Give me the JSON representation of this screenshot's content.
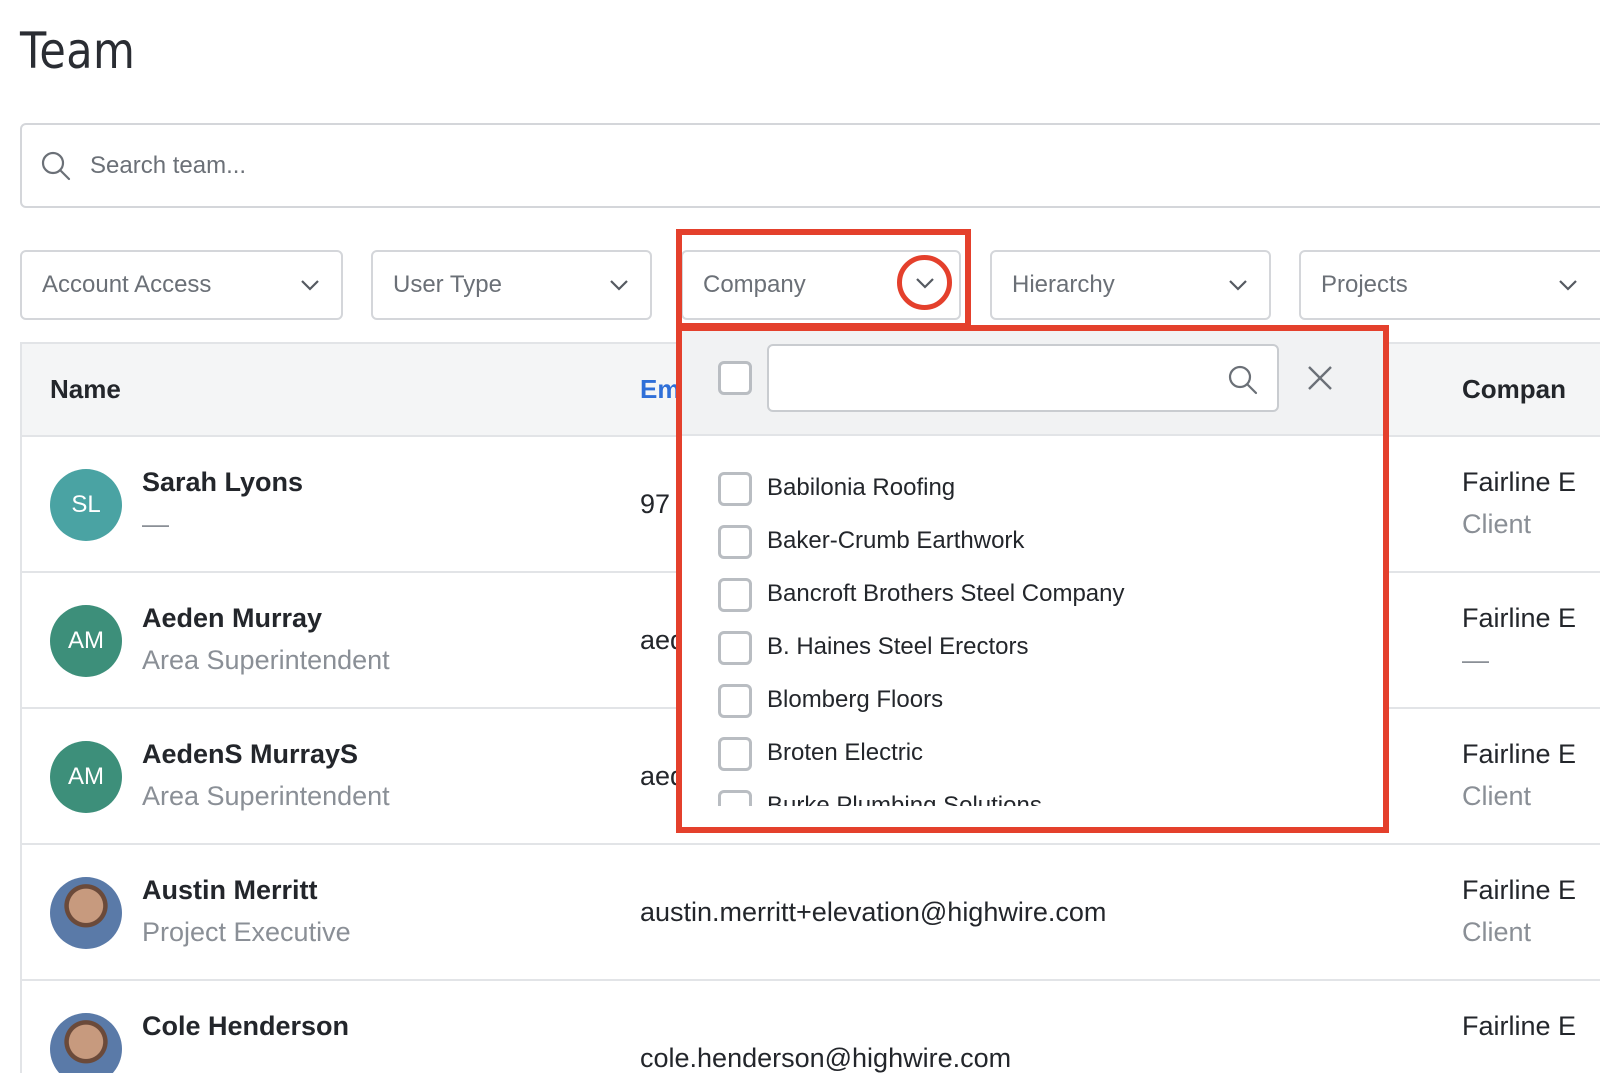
{
  "page": {
    "title": "Team"
  },
  "search": {
    "placeholder": "Search team..."
  },
  "filters": [
    {
      "label": "Account Access"
    },
    {
      "label": "User Type"
    },
    {
      "label": "Company"
    },
    {
      "label": "Hierarchy"
    },
    {
      "label": "Projects"
    }
  ],
  "table": {
    "headers": {
      "name": "Name",
      "email": "Em",
      "company": "Compan"
    },
    "rows": [
      {
        "initials": "SL",
        "avatar_color": "#4aa3a3",
        "name": "Sarah Lyons",
        "subtitle": "—",
        "email": "97",
        "company": "Fairline E",
        "company_sub": "Client"
      },
      {
        "initials": "AM",
        "avatar_color": "#3d8f7a",
        "name": "Aeden Murray",
        "subtitle": "Area Superintendent",
        "email": "aed",
        "company": "Fairline E",
        "company_sub": "—"
      },
      {
        "initials": "AM",
        "avatar_color": "#3d8f7a",
        "name": "AedenS MurrayS",
        "subtitle": "Area Superintendent",
        "email": "aed",
        "company": "Fairline E",
        "company_sub": "Client"
      },
      {
        "initials": "",
        "avatar_color": "",
        "name": "Austin Merritt",
        "subtitle": "Project Executive",
        "email": "austin.merritt+elevation@highwire.com",
        "company": "Fairline E",
        "company_sub": "Client"
      },
      {
        "initials": "",
        "avatar_color": "",
        "name": "Cole Henderson",
        "subtitle": "",
        "email": "cole.henderson@highwire.com",
        "company": "Fairline E",
        "company_sub": ""
      }
    ]
  },
  "company_dropdown": {
    "search_value": "",
    "options": [
      "Babilonia Roofing",
      "Baker-Crumb Earthwork",
      "Bancroft Brothers Steel Company",
      "B. Haines Steel Erectors",
      "Blomberg Floors",
      "Broten Electric",
      "Burke Plumbing Solutions"
    ]
  },
  "colors": {
    "highlight": "#e4402c",
    "link_blue": "#2f6fd8",
    "border": "#d4d6da"
  },
  "icons": {
    "search": "search-icon",
    "chevron": "chevron-down-icon",
    "close": "close-icon"
  }
}
